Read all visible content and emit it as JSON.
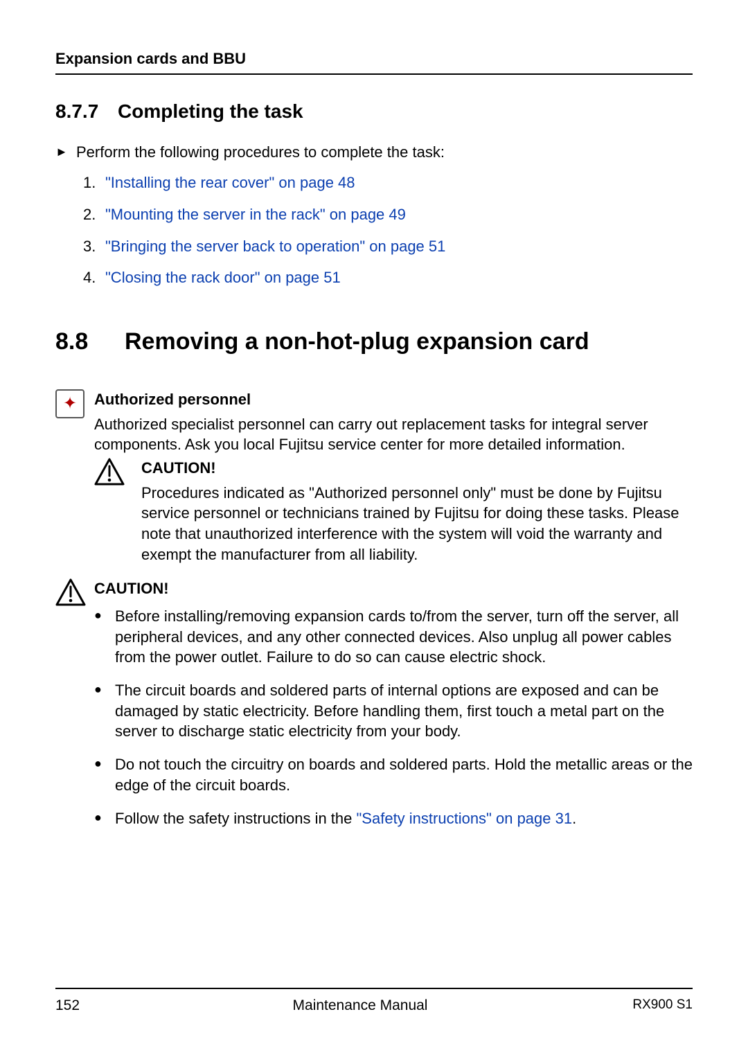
{
  "header": {
    "running_title": "Expansion cards and BBU"
  },
  "section_877": {
    "number": "8.7.7",
    "title": "Completing the task",
    "intro": "Perform the following procedures to complete the task:",
    "links": [
      "\"Installing the rear cover\" on page 48",
      "\"Mounting the server in the rack\" on page 49",
      "\"Bringing the server back to operation\" on page 51",
      "\"Closing the rack door\" on page 51"
    ]
  },
  "section_88": {
    "number": "8.8",
    "title": "Removing a non-hot-plug expansion card"
  },
  "authorized": {
    "title": "Authorized personnel",
    "body": "Authorized specialist personnel can carry out replacement tasks for integral server components. Ask you local Fujitsu service center for more detailed information."
  },
  "caution1": {
    "title": "CAUTION!",
    "body": "Procedures indicated as \"Authorized personnel only\" must be done by Fujitsu service personnel or technicians trained by Fujitsu for doing these tasks. Please note that unauthorized interference with the system will void the warranty and exempt the manufacturer from all liability."
  },
  "caution2": {
    "title": "CAUTION!",
    "bullets": [
      "Before installing/removing expansion cards to/from the server, turn off the server, all peripheral devices, and any other connected devices. Also unplug all power cables from the power outlet. Failure to do so can cause electric shock.",
      "The circuit boards and soldered parts of internal options are exposed and can be damaged by static electricity. Before handling them, first touch a metal part on the server to discharge static electricity from your body.",
      "Do not touch the circuitry on boards and soldered parts. Hold the metallic areas or the edge of the circuit boards."
    ],
    "last_prefix": "Follow the safety instructions in the ",
    "last_link": "\"Safety instructions\" on page 31",
    "last_suffix": "."
  },
  "footer": {
    "page": "152",
    "doc": "Maintenance Manual",
    "model": "RX900 S1"
  }
}
